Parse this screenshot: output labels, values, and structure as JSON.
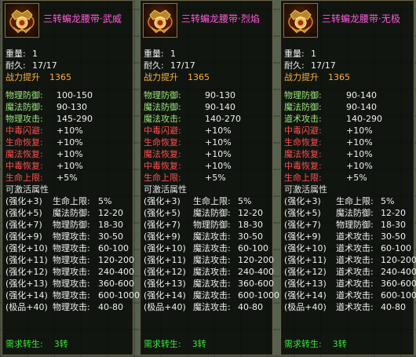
{
  "panels": [
    {
      "title": "三转蝙龙腰带·武威",
      "weight_label": "重量:",
      "weight": "1",
      "durability_label": "耐久:",
      "durability": "17/17",
      "power_label": "战力提升",
      "power": "1365",
      "stats": [
        {
          "k": "物理防御:",
          "v": "100-150",
          "c": "g"
        },
        {
          "k": "魔法防御:",
          "v": "90-130",
          "c": "g"
        },
        {
          "k": "物理攻击:",
          "v": "145-290",
          "c": "g"
        },
        {
          "k": "中毒闪避:",
          "v": "+10%",
          "c": "r"
        },
        {
          "k": "生命恢复:",
          "v": "+10%",
          "c": "r"
        },
        {
          "k": "魔法恢复:",
          "v": "+10%",
          "c": "r"
        },
        {
          "k": "中毒恢复:",
          "v": "+10%",
          "c": "r"
        },
        {
          "k": "生命上限:",
          "v": "+5%",
          "c": "r"
        }
      ],
      "activatable_label": "可激活属性",
      "upgrades": [
        {
          "lv": "(强化+3)",
          "k": "生命上限:",
          "v": "5%"
        },
        {
          "lv": "(强化+5)",
          "k": "魔法防御:",
          "v": "12-20"
        },
        {
          "lv": "(强化+7)",
          "k": "物理防御:",
          "v": "18-30"
        },
        {
          "lv": "(强化+9)",
          "k": "物理攻击:",
          "v": "30-50"
        },
        {
          "lv": "(强化+10)",
          "k": "物理攻击:",
          "v": "60-100"
        },
        {
          "lv": "(强化+11)",
          "k": "物理攻击:",
          "v": "120-200"
        },
        {
          "lv": "(强化+12)",
          "k": "物理攻击:",
          "v": "240-400"
        },
        {
          "lv": "(强化+13)",
          "k": "物理攻击:",
          "v": "360-600"
        },
        {
          "lv": "(强化+14)",
          "k": "物理攻击:",
          "v": "600-1000"
        },
        {
          "lv": "(极品+40)",
          "k": "物理攻击:",
          "v": "40-80"
        }
      ],
      "req_label": "需求转生:",
      "req_value": "3转"
    },
    {
      "title": "三转蝙龙腰带·烈焰",
      "weight_label": "重量:",
      "weight": "1",
      "durability_label": "耐久:",
      "durability": "17/17",
      "power_label": "战力提升",
      "power": "1365",
      "stats": [
        {
          "k": "物理防御:",
          "v": "90-130",
          "c": "g"
        },
        {
          "k": "魔法防御:",
          "v": "90-140",
          "c": "g"
        },
        {
          "k": "魔法攻击:",
          "v": "140-270",
          "c": "g"
        },
        {
          "k": "中毒闪避:",
          "v": "+10%",
          "c": "r"
        },
        {
          "k": "生命恢复:",
          "v": "+10%",
          "c": "r"
        },
        {
          "k": "魔法恢复:",
          "v": "+10%",
          "c": "r"
        },
        {
          "k": "中毒恢复:",
          "v": "+10%",
          "c": "r"
        },
        {
          "k": "生命上限:",
          "v": "+5%",
          "c": "r"
        }
      ],
      "activatable_label": "可激活属性",
      "upgrades": [
        {
          "lv": "(强化+3)",
          "k": "生命上限:",
          "v": "5%"
        },
        {
          "lv": "(强化+5)",
          "k": "魔法防御:",
          "v": "12-20"
        },
        {
          "lv": "(强化+7)",
          "k": "物理防御:",
          "v": "18-30"
        },
        {
          "lv": "(强化+9)",
          "k": "魔法攻击:",
          "v": "30-50"
        },
        {
          "lv": "(强化+10)",
          "k": "魔法攻击:",
          "v": "60-100"
        },
        {
          "lv": "(强化+11)",
          "k": "魔法攻击:",
          "v": "120-200"
        },
        {
          "lv": "(强化+12)",
          "k": "魔法攻击:",
          "v": "240-400"
        },
        {
          "lv": "(强化+13)",
          "k": "魔法攻击:",
          "v": "360-600"
        },
        {
          "lv": "(强化+14)",
          "k": "魔法攻击:",
          "v": "600-1000"
        },
        {
          "lv": "(极品+40)",
          "k": "魔法攻击:",
          "v": "40-80"
        }
      ],
      "req_label": "需求转生:",
      "req_value": "3转"
    },
    {
      "title": "三转蝙龙腰带·无极",
      "weight_label": "重量:",
      "weight": "1",
      "durability_label": "耐久:",
      "durability": "17/17",
      "power_label": "战力提升",
      "power": "1365",
      "stats": [
        {
          "k": "物理防御:",
          "v": "90-140",
          "c": "g"
        },
        {
          "k": "魔法防御:",
          "v": "90-140",
          "c": "g"
        },
        {
          "k": "道术攻击:",
          "v": "140-290",
          "c": "g"
        },
        {
          "k": "中毒闪避:",
          "v": "+10%",
          "c": "r"
        },
        {
          "k": "生命恢复:",
          "v": "+10%",
          "c": "r"
        },
        {
          "k": "魔法恢复:",
          "v": "+10%",
          "c": "r"
        },
        {
          "k": "中毒恢复:",
          "v": "+10%",
          "c": "r"
        },
        {
          "k": "生命上限:",
          "v": "+5%",
          "c": "r"
        }
      ],
      "activatable_label": "可激活属性",
      "upgrades": [
        {
          "lv": "(强化+3)",
          "k": "生命上限:",
          "v": "5%"
        },
        {
          "lv": "(强化+5)",
          "k": "魔法防御:",
          "v": "12-20"
        },
        {
          "lv": "(强化+7)",
          "k": "物理防御:",
          "v": "18-30"
        },
        {
          "lv": "(强化+9)",
          "k": "道术攻击:",
          "v": "30-50"
        },
        {
          "lv": "(强化+10)",
          "k": "道术攻击:",
          "v": "60-100"
        },
        {
          "lv": "(强化+11)",
          "k": "道术攻击:",
          "v": "120-200"
        },
        {
          "lv": "(强化+12)",
          "k": "道术攻击:",
          "v": "240-400"
        },
        {
          "lv": "(强化+13)",
          "k": "道术攻击:",
          "v": "360-600"
        },
        {
          "lv": "(强化+14)",
          "k": "道术攻击:",
          "v": "600-1000"
        },
        {
          "lv": "(极品+40)",
          "k": "道术攻击:",
          "v": "40-80"
        }
      ],
      "req_label": "需求转生:",
      "req_value": "3转"
    }
  ],
  "icons": {
    "item": "belt-item-icon"
  },
  "colors": {
    "title": "#ff5ad8",
    "power": "#ffb040",
    "base_stat": "#9fe87e",
    "bonus_stat": "#ff5050",
    "requirement": "#38e838"
  }
}
